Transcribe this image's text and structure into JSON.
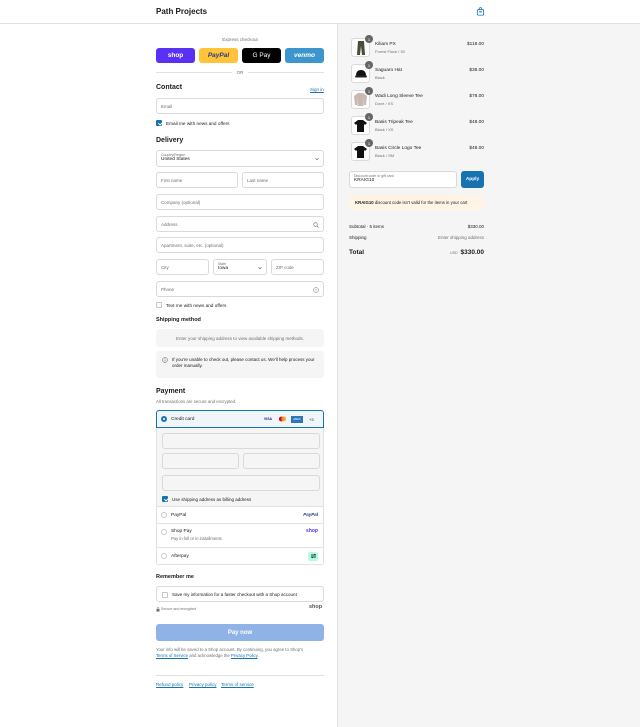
{
  "header": {
    "brand": "Path Projects",
    "cart_icon": "shopping-bag-icon"
  },
  "express": {
    "title": "Express checkout",
    "shop": "shop",
    "paypal": "PayPal",
    "gpay": "G Pay",
    "venmo": "venmo",
    "or": "OR"
  },
  "contact": {
    "title": "Contact",
    "sign_in": "Sign in",
    "email_placeholder": "Email",
    "news_label": "Email me with news and offers"
  },
  "delivery": {
    "title": "Delivery",
    "country_label": "Country/Region",
    "country_value": "United States",
    "first_name": "First name",
    "last_name": "Last name",
    "company": "Company (optional)",
    "address": "Address",
    "apartment": "Apartment, suite, etc. (optional)",
    "city": "City",
    "state_label": "State",
    "state_value": "Iowa",
    "zip": "ZIP code",
    "phone": "Phone",
    "text_news": "Text me with news and offers"
  },
  "shipping": {
    "title": "Shipping method",
    "placeholder": "Enter your shipping address to view available shipping methods.",
    "notice": "If you're unable to check out, please contact us. We'll help process your order manually."
  },
  "payment": {
    "title": "Payment",
    "subtitle": "All transactions are secure and encrypted.",
    "credit_card": "Credit card",
    "card_brands": [
      "VISA",
      "MC",
      "AMEX",
      "+3"
    ],
    "billing_same": "Use shipping address as billing address",
    "paypal": "PayPal",
    "paypal_logo": "PayPal",
    "shop_pay": "Shop Pay",
    "shop_pay_sub": "Pay in full or in installments",
    "shop_logo": "shop",
    "afterpay": "Afterpay"
  },
  "remember": {
    "title": "Remember me",
    "save_label": "Save my information for a faster checkout with a Shop account",
    "secure": "Secure and encrypted",
    "shop_logo": "shop"
  },
  "pay_button": "Pay now",
  "legal": {
    "text_1": "Your info will be saved to a Shop account. By continuing, you agree to Shop's",
    "terms": "Terms of Service",
    "text_2": "and acknowledge the",
    "privacy": "Privacy Policy",
    "text_3": "."
  },
  "footer_links": [
    "Refund policy",
    "Privacy policy",
    "Terms of service"
  ],
  "cart": {
    "items": [
      {
        "name": "Kiliam PX",
        "variant": "Forest Flock / 30",
        "price": "$118.00",
        "qty": "1"
      },
      {
        "name": "Saguaro Hat",
        "variant": "Black",
        "price": "$38.00",
        "qty": "1"
      },
      {
        "name": "Wadi Long Sleeve Tee",
        "variant": "Dove / XS",
        "price": "$78.00",
        "qty": "1"
      },
      {
        "name": "Basis Tripeak Tee",
        "variant": "Black / XS",
        "price": "$48.00",
        "qty": "1"
      },
      {
        "name": "Basis Circle Logo Tee",
        "variant": "Black / SM",
        "price": "$48.00",
        "qty": "1"
      }
    ],
    "discount_label": "Discount code or gift card",
    "discount_value": "KRAIG10",
    "apply": "Apply",
    "error_code": "KRAIG10",
    "error_text": "discount code isn't valid for the items in your cart",
    "subtotal_label": "Subtotal · 5 items",
    "subtotal": "$330.00",
    "shipping_label": "Shipping",
    "shipping_value": "Enter shipping address",
    "total_label": "Total",
    "currency": "USD",
    "total": "$330.00"
  },
  "colors": {
    "accent": "#1773b0",
    "shop": "#5a31f4",
    "paypal": "#ffc439",
    "venmo": "#3d95ce",
    "pay_button": "#8fb3e6"
  }
}
